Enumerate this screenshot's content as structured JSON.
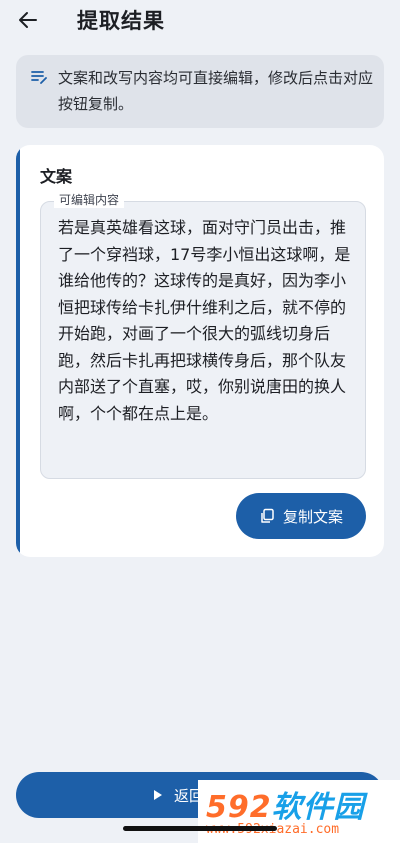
{
  "header": {
    "title": "提取结果",
    "back_icon": "arrow-left-icon"
  },
  "notice": {
    "icon": "edit-note-icon",
    "text": "文案和改写内容均可直接编辑，修改后点击对应按钮复制。"
  },
  "card": {
    "title": "文案",
    "editor_label": "可编辑内容",
    "editor_text": "若是真英雄看这球，面对守门员出击，推了一个穿裆球，17号李小恒出这球啊，是谁给他传的？这球传的是真好，因为李小恒把球传给卡扎伊什维利之后，就不停的开始跑，对画了一个很大的弧线切身后跑，然后卡扎再把球横传身后，那个队友内部送了个直塞，哎，你别说唐田的换人啊，个个都在点上是。",
    "copy_button_label": "复制文案",
    "copy_icon": "copy-icon"
  },
  "bottom_button": {
    "label": "返回",
    "icon": "play-icon"
  },
  "watermark": {
    "logo_num": "592",
    "logo_text": "软件园",
    "url": "www.592xiazai.com"
  },
  "colors": {
    "accent": "#1d5fa8",
    "background": "#eef1f6",
    "notice_bg": "#dfe3ea"
  }
}
